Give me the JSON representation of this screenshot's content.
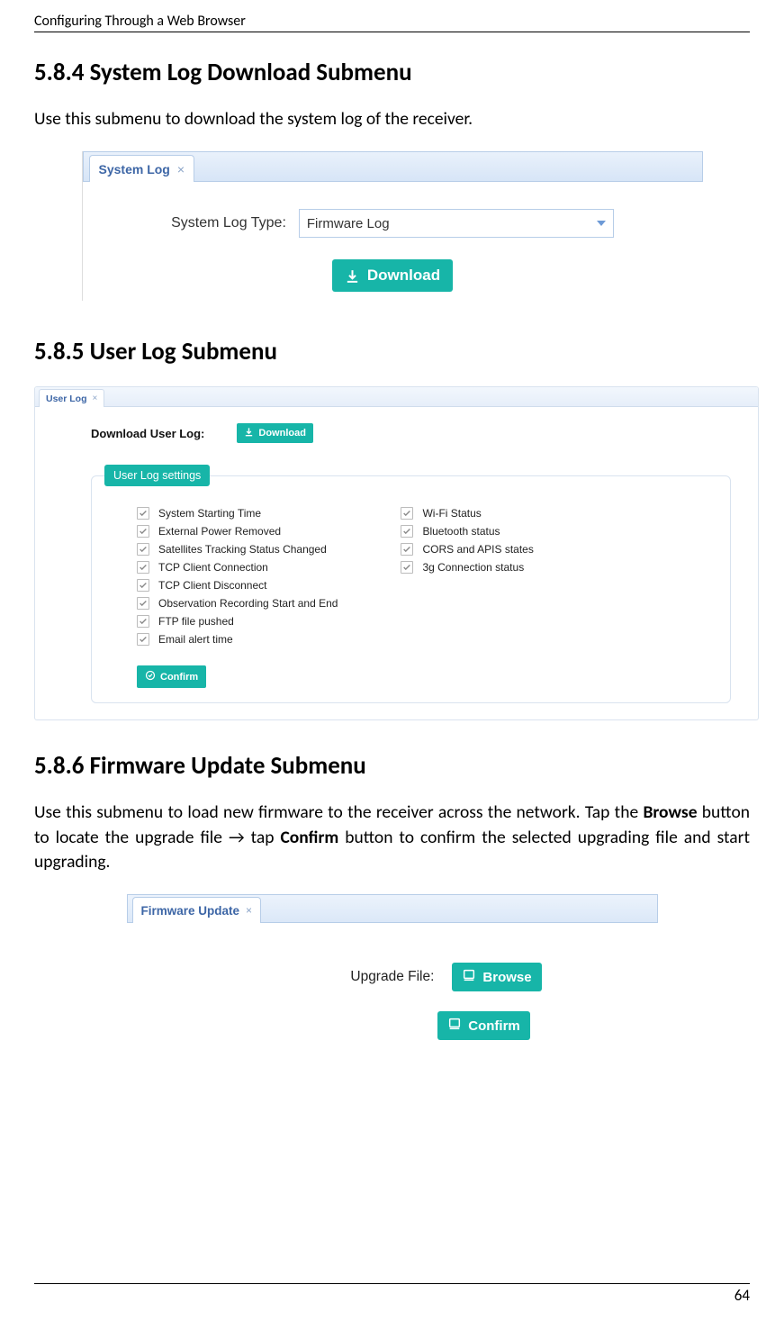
{
  "header": {
    "title": "Configuring Through a Web Browser"
  },
  "footer": {
    "page": "64"
  },
  "s584": {
    "heading": "5.8.4 System Log Download Submenu",
    "para": "Use this submenu to download the system log of the receiver.",
    "fig": {
      "tab_label": "System Log",
      "field_label": "System Log Type:",
      "select_value": "Firmware Log",
      "download_label": "Download"
    }
  },
  "s585": {
    "heading": "5.8.5 User Log Submenu",
    "fig": {
      "tab_label": "User Log",
      "dl_label": "Download User Log:",
      "dl_button": "Download",
      "legend": "User Log settings",
      "left": [
        "System Starting Time",
        "External Power Removed",
        "Satellites Tracking Status Changed",
        "TCP Client Connection",
        "TCP Client Disconnect",
        "Observation Recording Start and End",
        "FTP file pushed",
        "Email alert time"
      ],
      "right": [
        "Wi-Fi Status",
        "Bluetooth status",
        "CORS and APIS states",
        "3g Connection status"
      ],
      "confirm_label": "Confirm"
    }
  },
  "s586": {
    "heading": "5.8.6 Firmware Update Submenu",
    "para_pre": "Use this submenu to load new firmware to the receiver across the network. Tap the ",
    "para_bold1": "Browse",
    "para_mid": " button to locate the upgrade file → tap ",
    "para_bold2": "Confirm",
    "para_post": " button to confirm the selected upgrading file and start upgrading.",
    "fig": {
      "tab_label": "Firmware Update",
      "field_label": "Upgrade File:",
      "browse_label": "Browse",
      "confirm_label": "Confirm"
    }
  }
}
